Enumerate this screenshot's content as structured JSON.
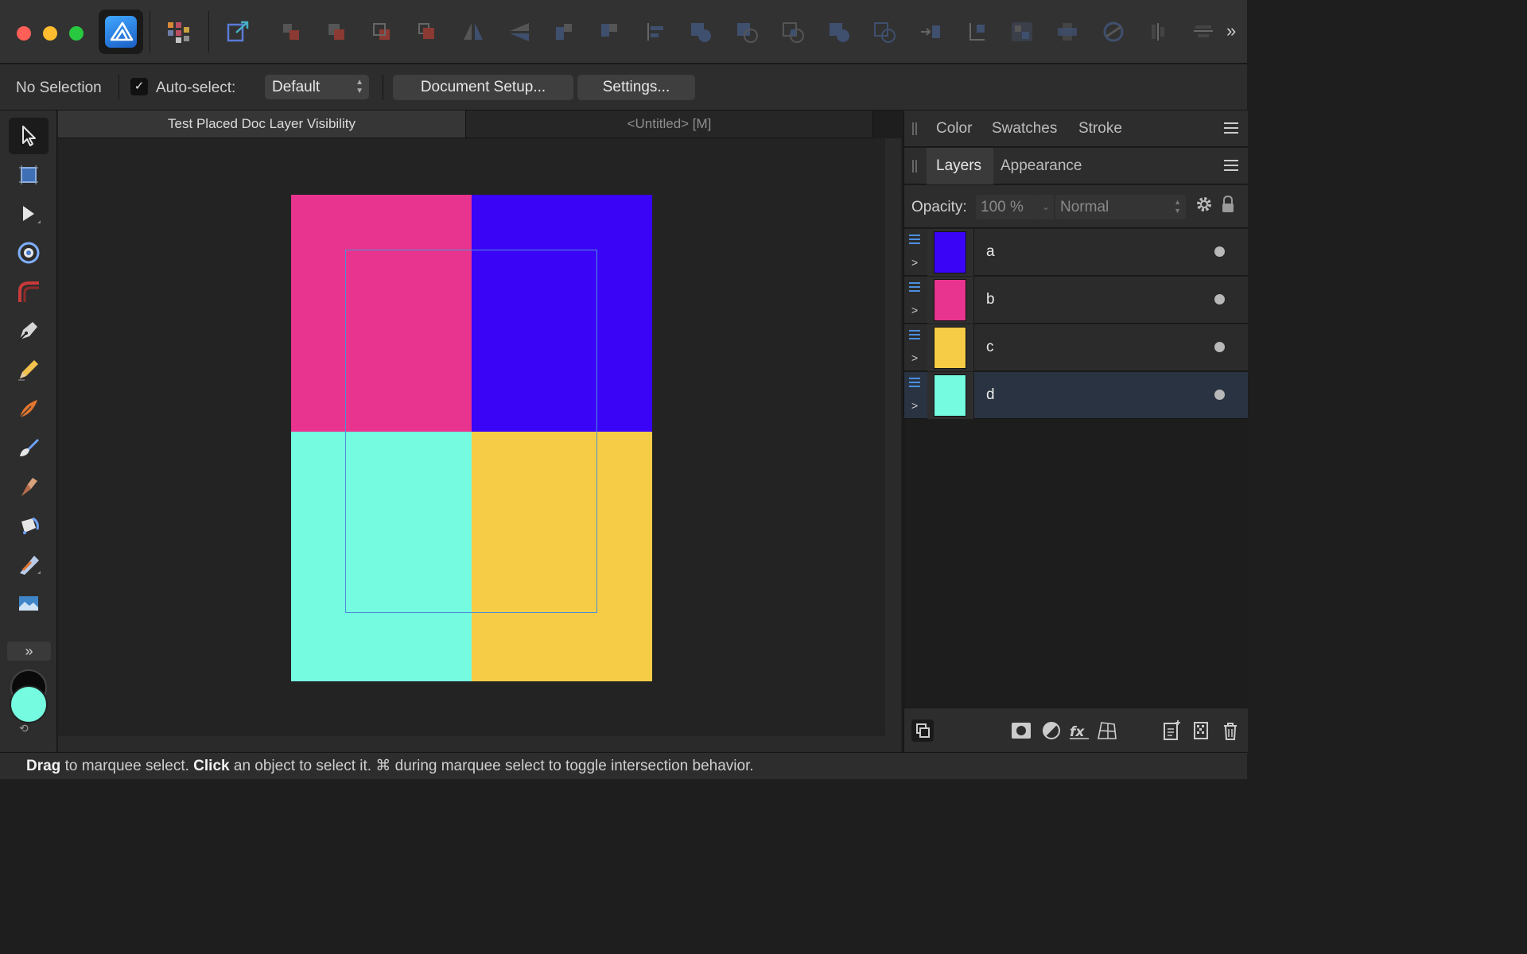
{
  "window": {
    "traffic_lights": [
      "close",
      "minimize",
      "maximize"
    ]
  },
  "toolbar": {
    "app_icon": "affinity-designer-icon",
    "icons": [
      "persona-switch-icon",
      "export-persona-icon",
      "move-back-icon",
      "move-backward-icon",
      "move-forward-icon",
      "move-front-icon",
      "flip-horizontal-icon",
      "flip-vertical-icon",
      "rotate-left-icon",
      "rotate-right-icon",
      "align-icon",
      "add-boolean-icon",
      "subtract-boolean-icon",
      "intersect-boolean-icon",
      "xor-boolean-icon",
      "divide-boolean-icon",
      "insert-target-icon",
      "group-target-icon",
      "insert-inside-icon",
      "order-icon",
      "snapping-icon",
      "view-tools-icon",
      "distribute-icon",
      "more-icon"
    ],
    "overflow_label": "»"
  },
  "context": {
    "selection": "No Selection",
    "autoselect_checked": "✓",
    "autoselect_label": "Auto-select:",
    "autoselect_value": "Default",
    "document_setup": "Document Setup...",
    "settings": "Settings..."
  },
  "tools": {
    "items": [
      "move-tool",
      "artboard-tool",
      "node-tool",
      "corner-tool",
      "point-transform-tool",
      "pen-tool",
      "pencil-tool",
      "vector-brush-tool",
      "paint-brush-tool",
      "fill-tool",
      "transparency-tool",
      "gradient-tool",
      "place-image-tool"
    ],
    "expand_label": "»",
    "fill_color": "#74fbe0",
    "stroke_color": "#000000",
    "swap_label": "⟲"
  },
  "document": {
    "tabs": [
      {
        "label": "Test Placed Doc Layer Visibility",
        "active": true
      },
      {
        "label": "<Untitled> [M]",
        "active": false
      }
    ],
    "artboard": {
      "quadrants": [
        {
          "name": "pink",
          "color": "#e8348e"
        },
        {
          "name": "blue",
          "color": "#3a04f7"
        },
        {
          "name": "cyan",
          "color": "#74fbe0"
        },
        {
          "name": "yellow",
          "color": "#f6cc46"
        }
      ],
      "frame_color": "#4d8fd8"
    }
  },
  "panels": {
    "top_tabs": [
      "Color",
      "Swatches",
      "Stroke"
    ],
    "layers_tabs": [
      "Layers",
      "Appearance"
    ],
    "opacity_label": "Opacity:",
    "opacity_value": "100 %",
    "blend_mode": "Normal",
    "layers": [
      {
        "name": "a",
        "color": "#3a04f7",
        "selected": false
      },
      {
        "name": "b",
        "color": "#e8348e",
        "selected": false
      },
      {
        "name": "c",
        "color": "#f6cc46",
        "selected": false
      },
      {
        "name": "d",
        "color": "#74fbe0",
        "selected": true
      }
    ],
    "bottom_icons": [
      "layer-options-icon",
      "mask-icon",
      "adjustment-icon",
      "fx-icon",
      "mesh-icon",
      "add-layer-icon",
      "add-pixel-layer-icon",
      "delete-layer-icon"
    ]
  },
  "status": {
    "drag": "Drag",
    "text1": " to marquee select. ",
    "click": "Click",
    "text2": " an object to select it. ⌘ during marquee select to toggle intersection behavior."
  }
}
